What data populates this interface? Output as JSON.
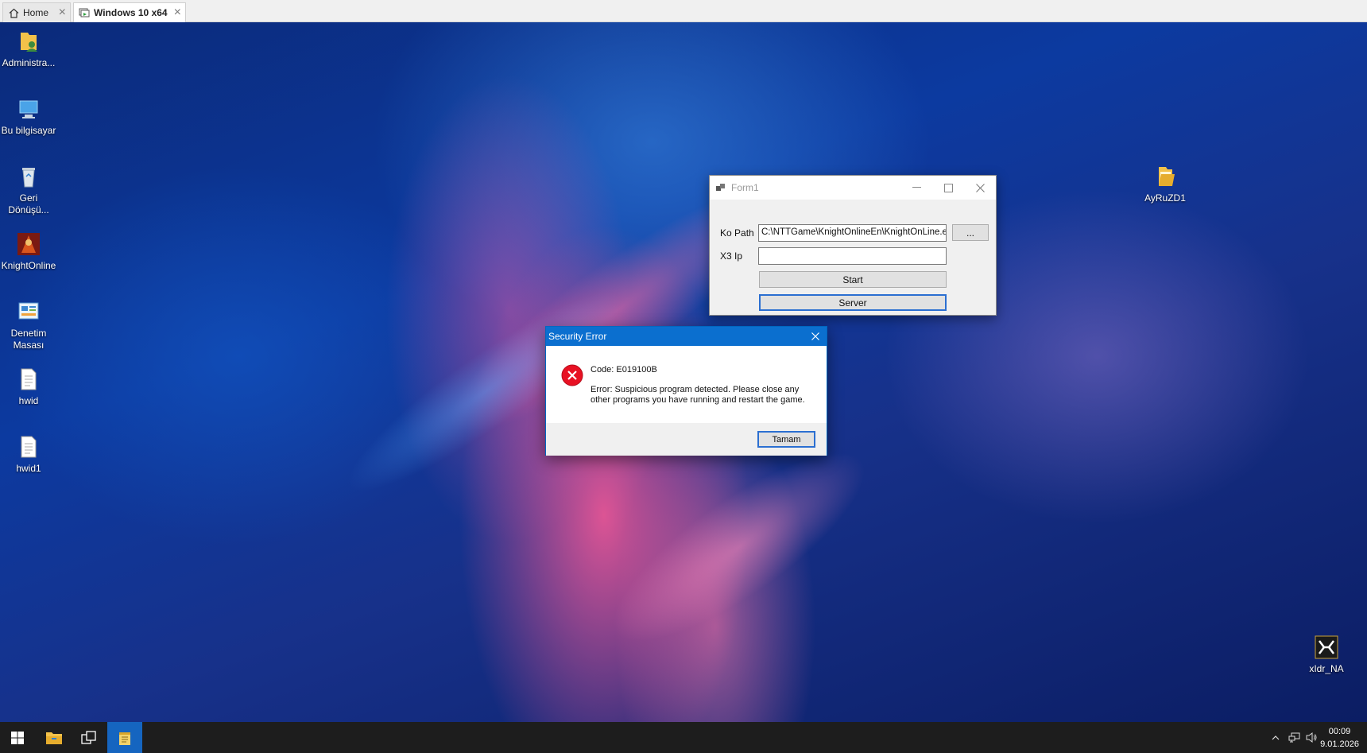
{
  "vm_tabs": [
    {
      "label": "Home",
      "icon": "home-icon"
    },
    {
      "label": "Windows 10 x64",
      "icon": "vm-icon"
    }
  ],
  "desktop_icons": [
    {
      "label": "Administra...",
      "icon": "user-folder-icon"
    },
    {
      "label": "Bu bilgisayar",
      "icon": "computer-icon"
    },
    {
      "label": "Geri Dönüşü...",
      "icon": "recycle-bin-icon"
    },
    {
      "label": "KnightOnline",
      "icon": "knightonline-icon"
    },
    {
      "label": "Denetim Masası",
      "icon": "control-panel-icon"
    },
    {
      "label": "hwid",
      "icon": "text-file-icon"
    },
    {
      "label": "hwid1",
      "icon": "text-file-icon"
    },
    {
      "label": "AyRuZD1",
      "icon": "folder-icon"
    },
    {
      "label": "xIdr_NA",
      "icon": "app-icon"
    }
  ],
  "form1": {
    "title": "Form1",
    "ko_path_label": "Ko Path",
    "ko_path_value": "C:\\NTTGame\\KnightOnlineEn\\KnightOnLine.exe",
    "browse_label": "...",
    "x3_ip_label": "X3 Ip",
    "x3_ip_value": "",
    "start_label": "Start",
    "server_label": "Server"
  },
  "security_dialog": {
    "title": "Security Error",
    "code": "Code: E019100B",
    "message": "Error: Suspicious program detected. Please close any other programs you have running and restart the game.",
    "ok_label": "Tamam"
  },
  "taskbar": {
    "time": "00:09",
    "date": "9.01.2026"
  },
  "colors": {
    "dialog_titlebar": "#0b6fcf",
    "error_red": "#e81123",
    "taskbar": "#1d1d1d",
    "taskbar_active": "#1565c0"
  }
}
